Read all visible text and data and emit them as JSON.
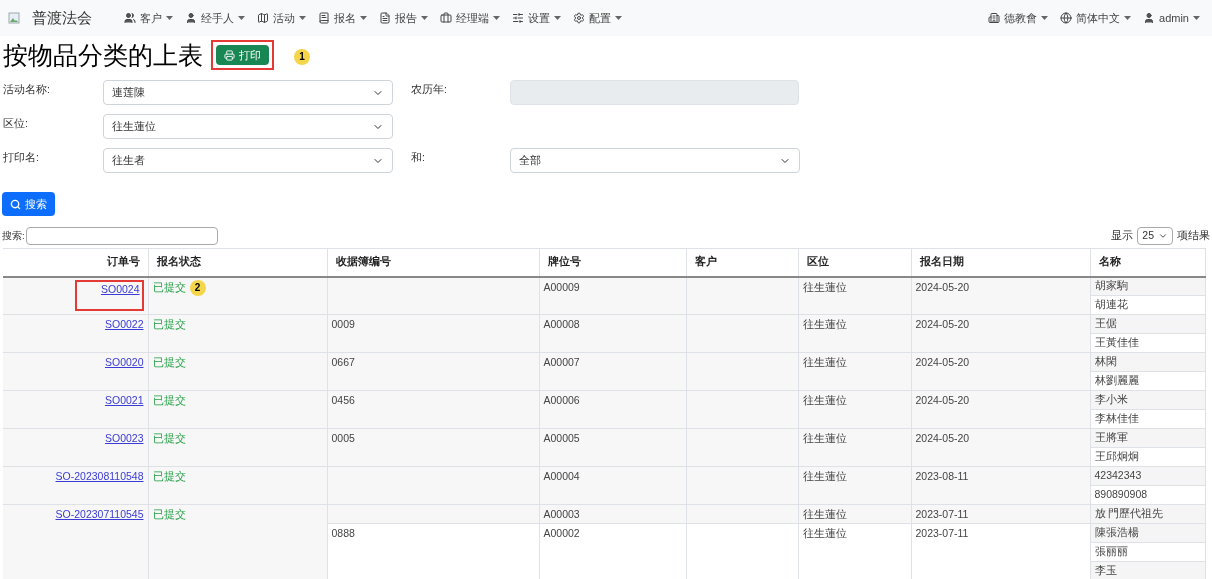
{
  "navbar": {
    "brand": "普渡法会",
    "menus": [
      {
        "label": "客户"
      },
      {
        "label": "经手人"
      },
      {
        "label": "活动"
      },
      {
        "label": "报名"
      },
      {
        "label": "报告"
      },
      {
        "label": "经理端"
      },
      {
        "label": "设置"
      },
      {
        "label": "配置"
      }
    ],
    "right": [
      {
        "label": "德教會"
      },
      {
        "label": "简体中文"
      },
      {
        "label": "admin"
      }
    ]
  },
  "title": "按物品分类的上表",
  "print_button": "打印",
  "callouts": [
    "1",
    "2"
  ],
  "filters": [
    [
      {
        "label": "活动名称:",
        "kind": "select",
        "value": "連莲陳"
      },
      {
        "label": "农历年:",
        "kind": "readonly"
      }
    ],
    [
      {
        "label": "区位:",
        "kind": "select",
        "value": "往生蓮位"
      }
    ],
    [
      {
        "label": "打印名:",
        "kind": "select",
        "value": "往生者"
      },
      {
        "label": "和:",
        "kind": "select",
        "value": "全部"
      }
    ]
  ],
  "search_button": "搜索",
  "table_search_label": "搜索:",
  "page_size": {
    "prefix": "显示",
    "value": "25",
    "suffix": "项结果"
  },
  "table": {
    "columns": [
      "订单号",
      "报名状态",
      "收据簿编号",
      "牌位号",
      "客户",
      "区位",
      "报名日期",
      "名称"
    ],
    "rows": [
      {
        "order": "SO0024",
        "status": "已提交",
        "groups": [
          {
            "tablet": "A00009",
            "zone": "往生蓮位",
            "date": "2024-05-20",
            "names": [
              "胡家駒",
              "胡連花"
            ]
          }
        ]
      },
      {
        "order": "SO0022",
        "status": "已提交",
        "groups": [
          {
            "receipt": "0009",
            "tablet": "A00008",
            "zone": "往生蓮位",
            "date": "2024-05-20",
            "names": [
              "王倨",
              "王黃佳佳"
            ]
          }
        ]
      },
      {
        "order": "SO0020",
        "status": "已提交",
        "groups": [
          {
            "receipt": "0667",
            "tablet": "A00007",
            "zone": "往生蓮位",
            "date": "2024-05-20",
            "names": [
              "林閑",
              "林劉麗麗"
            ]
          }
        ]
      },
      {
        "order": "SO0021",
        "status": "已提交",
        "groups": [
          {
            "receipt": "0456",
            "tablet": "A00006",
            "zone": "往生蓮位",
            "date": "2024-05-20",
            "names": [
              "李小米",
              "李林佳佳"
            ]
          }
        ]
      },
      {
        "order": "SO0023",
        "status": "已提交",
        "groups": [
          {
            "receipt": "0005",
            "tablet": "A00005",
            "zone": "往生蓮位",
            "date": "2024-05-20",
            "names": [
              "王將軍",
              "王邱炯炯"
            ]
          }
        ]
      },
      {
        "order": "SO-202308110548",
        "status": "已提交",
        "groups": [
          {
            "tablet": "A00004",
            "zone": "往生蓮位",
            "date": "2023-08-11",
            "names": [
              "42342343",
              "890890908"
            ]
          }
        ]
      },
      {
        "order": "SO-202307110545",
        "status": "已提交",
        "groups": [
          {
            "tablet": "A00003",
            "zone": "往生蓮位",
            "date": "2023-07-11",
            "names": [
              "放 門歷代祖先"
            ]
          },
          {
            "receipt": "0888",
            "tablet": "A00002",
            "zone": "往生蓮位",
            "date": "2023-07-11",
            "names": [
              "陳張浩楊",
              "張丽丽",
              "李玉"
            ]
          }
        ]
      }
    ]
  }
}
